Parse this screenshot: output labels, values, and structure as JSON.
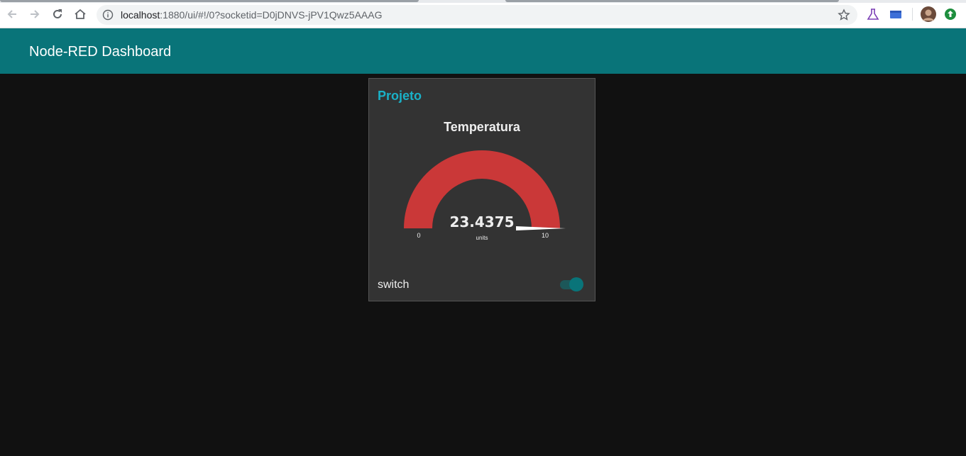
{
  "browser": {
    "url_host": "localhost",
    "url_rest": ":1880/ui/#!/0?socketid=D0jDNVS-jPV1Qwz5AAAG"
  },
  "toolbar": {
    "title": "Node-RED Dashboard"
  },
  "group": {
    "title": "Projeto",
    "gauge": {
      "title": "Temperatura",
      "value": 23.4375,
      "value_label": "23.4375",
      "units": "units",
      "min": 0,
      "max": 10,
      "min_label": "0",
      "max_label": "10",
      "color": "#ca3838"
    },
    "switch": {
      "label": "switch",
      "state": true,
      "color": "#097479"
    }
  },
  "colors": {
    "toolbar": "#097479",
    "background": "#111111",
    "card": "#333333",
    "group_title": "#1ab1c7"
  }
}
